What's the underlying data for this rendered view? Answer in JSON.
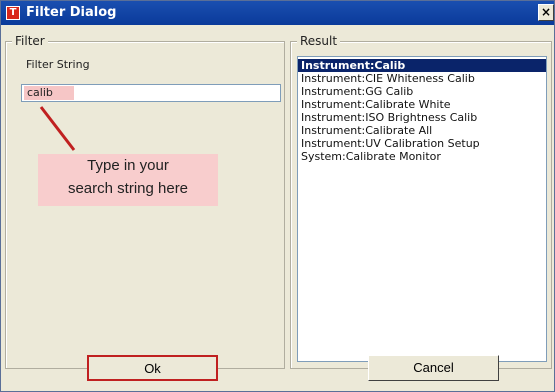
{
  "window": {
    "title": "Filter Dialog",
    "app_icon_letter": "T",
    "close_glyph": "×"
  },
  "filter": {
    "group_label": "Filter",
    "field_label": "Filter String",
    "value": "calib",
    "callout": {
      "line1": "Type in your",
      "line2": "search string here"
    }
  },
  "result": {
    "group_label": "Result",
    "items": [
      "Instrument:Calib",
      "Instrument:CIE Whiteness Calib",
      "Instrument:GG Calib",
      "Instrument:Calibrate White",
      "Instrument:ISO Brightness Calib",
      "Instrument:Calibrate All",
      "Instrument:UV Calibration Setup",
      "System:Calibrate Monitor"
    ],
    "selected_index": 0
  },
  "buttons": {
    "ok": "Ok",
    "cancel": "Cancel"
  },
  "colors": {
    "titlebar": "#0a3a9a",
    "selection": "#0a246a",
    "highlight": "#f8cdcd",
    "callout_arrow": "#c02020"
  }
}
